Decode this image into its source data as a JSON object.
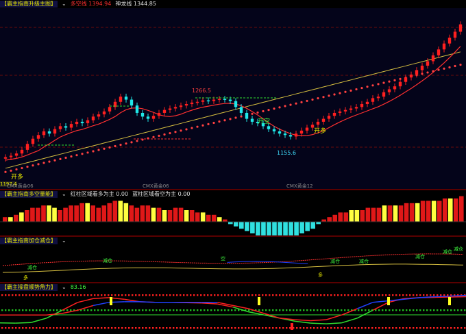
{
  "colors": {
    "up": "#ff2020",
    "down": "#20e8e8",
    "ma_red": "#ff3030",
    "ma_yellow": "#d8c040",
    "green": "#30e030",
    "blue": "#2040ff",
    "label_red": "#ff4040",
    "label_yellow": "#e6e600",
    "label_cyan": "#40e0ff",
    "label_green": "#40ff40"
  },
  "panel1": {
    "title": "【霸主指南升级主图】",
    "legend": [
      {
        "text": "多空线 1394.94",
        "color": "#ff3030"
      },
      {
        "text": "神龙线 1344.85",
        "color": "#e0e0e0"
      }
    ],
    "left_marker": "1197.4",
    "sub_labels": [
      {
        "text": "CMX黄金06",
        "type": "left"
      },
      {
        "text": "CMX黄金06",
        "type": "mid"
      },
      {
        "text": "CMX黄金12",
        "type": "right"
      }
    ]
  },
  "panel2": {
    "title": "【霸主指南多空量能】",
    "legend": [
      {
        "text": "红柱区域看多为主 0.00",
        "color": "#e0e0e0"
      },
      {
        "text": "蓝柱区域看空为主 0.00",
        "color": "#e0e0e0"
      }
    ]
  },
  "panel3": {
    "title": "【霸主指南加仓减仓】",
    "legend": []
  },
  "panel4": {
    "title": "【霸主操盘顺势角力】",
    "legend": [
      {
        "text": "83.16",
        "color": "#40ff40"
      }
    ]
  },
  "chart_data": [
    {
      "type": "candlestick",
      "panel": "price",
      "annotations": [
        {
          "text": "1266.5",
          "kind": "high"
        },
        {
          "text": "1155.6",
          "kind": "low"
        },
        {
          "text": "开空",
          "kind": "signal"
        },
        {
          "text": "开多",
          "kind": "signal"
        },
        {
          "text": "开多",
          "kind": "signal"
        }
      ],
      "candles": [
        1180,
        1182,
        1185,
        1190,
        1198,
        1205,
        1210,
        1215,
        1212,
        1218,
        1222,
        1220,
        1225,
        1228,
        1226,
        1230,
        1235,
        1238,
        1242,
        1248,
        1255,
        1262,
        1258,
        1250,
        1240,
        1235,
        1232,
        1236,
        1240,
        1244,
        1246,
        1248,
        1250,
        1252,
        1254,
        1255,
        1257,
        1256,
        1258,
        1259,
        1258,
        1256,
        1248,
        1240,
        1232,
        1228,
        1226,
        1222,
        1218,
        1215,
        1212,
        1210,
        1208,
        1212,
        1216,
        1220,
        1224,
        1228,
        1232,
        1236,
        1240,
        1242,
        1244,
        1246,
        1248,
        1252,
        1255,
        1260,
        1262,
        1268,
        1272,
        1276,
        1282,
        1288,
        1292,
        1298,
        1304,
        1310,
        1318,
        1326,
        1334,
        1342,
        1350,
        1360
      ]
    },
    {
      "type": "bar",
      "panel": "volume",
      "values": [
        2,
        2,
        3,
        4,
        5,
        6,
        6,
        7,
        7,
        6,
        5,
        6,
        7,
        7,
        8,
        8,
        7,
        6,
        7,
        8,
        9,
        9,
        8,
        7,
        6,
        7,
        7,
        6,
        6,
        5,
        5,
        6,
        6,
        5,
        5,
        4,
        4,
        3,
        3,
        2,
        1,
        -1,
        -2,
        -3,
        -4,
        -5,
        -6,
        -6,
        -7,
        -7,
        -8,
        -8,
        -7,
        -6,
        -5,
        -4,
        -3,
        -1,
        1,
        2,
        3,
        4,
        4,
        5,
        5,
        5,
        6,
        6,
        6,
        7,
        7,
        7,
        7,
        8,
        8,
        8,
        9,
        9,
        9,
        9,
        10,
        10,
        10,
        11
      ]
    },
    {
      "type": "line",
      "panel": "position",
      "labels": [
        "减仓",
        "减仓",
        "空",
        "减仓",
        "减仓",
        "减仓",
        "减仓",
        "减仓",
        "多",
        "多"
      ]
    },
    {
      "type": "line",
      "panel": "trend",
      "series": [
        {
          "values": [
            0.05,
            0.04,
            0.06,
            0.2,
            0.45,
            0.7,
            0.82,
            0.85,
            0.8,
            0.72,
            0.7,
            0.7,
            0.69,
            0.68,
            0.65,
            0.55,
            0.4,
            0.3,
            0.2,
            0.1,
            0.04,
            0.02,
            0.05,
            0.2,
            0.45,
            0.7,
            0.82,
            0.85,
            0.86,
            0.87,
            0.88
          ]
        },
        {
          "values": [
            0.3,
            0.3,
            0.3,
            0.3,
            0.35,
            0.45,
            0.6,
            0.7,
            0.72,
            0.72,
            0.7,
            0.7,
            0.7,
            0.7,
            0.7,
            0.6,
            0.5,
            0.35,
            0.2,
            0.15,
            0.12,
            0.15,
            0.3,
            0.5,
            0.7,
            0.75,
            0.8,
            0.85,
            0.88,
            0.9,
            0.92
          ]
        }
      ]
    }
  ]
}
